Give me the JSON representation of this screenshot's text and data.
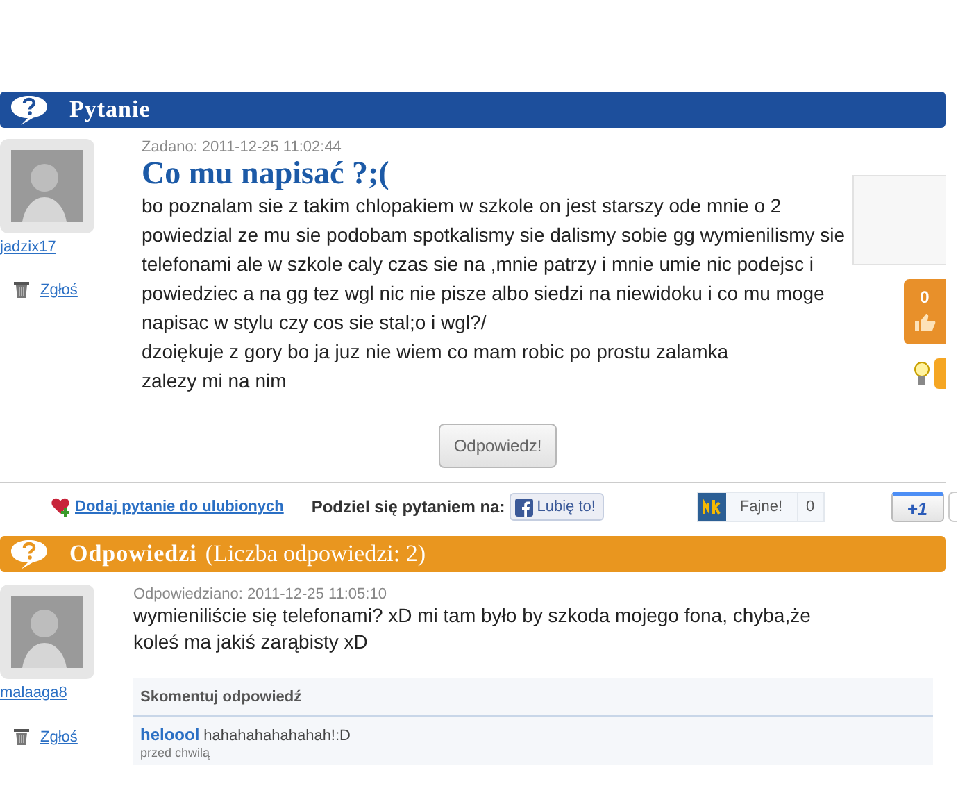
{
  "question_header": {
    "title": "Pytanie"
  },
  "question": {
    "author": "jadzix17",
    "report": "Zgłoś",
    "asked": "Zadano: 2011-12-25 11:02:44",
    "title": "Co mu napisać ?;(",
    "body": [
      "bo poznalam sie z takim chlopakiem w szkole on jest starszy ode mnie o 2",
      "powiedzial ze mu sie podobam spotkalismy sie dalismy sobie gg wymienilismy sie",
      "telefonami ale w szkole caly czas sie na ,mnie patrzy i mnie umie nic podejsc i",
      "powiedziec a na gg tez wgl nic nie pisze albo siedzi na niewidoku i co mu moge",
      "napisac w stylu czy cos sie stal;o i wgl?/",
      "dzoiękuje z gory bo ja juz nie wiem co mam robic po prostu zalamka",
      "zalezy mi na nim"
    ],
    "votes": "0",
    "answer_button": "Odpowiedz!"
  },
  "share": {
    "favorite": "Dodaj pytanie do ulubionych",
    "label": "Podziel się pytaniem na:",
    "facebook": "Lubię to!",
    "nk_label": "Fajne!",
    "nk_count": "0",
    "plus_one": "+1"
  },
  "answers_header": {
    "title": "Odpowiedzi",
    "count": "(Liczba odpowiedzi: 2)"
  },
  "answers": [
    {
      "author": "malaaga8",
      "report": "Zgłoś",
      "answered": "Odpowiedziano: 2011-12-25 11:05:10",
      "body": [
        "wymieniliście się telefonami? xD mi tam było by szkoda mojego fona, chyba,że",
        "koleś ma jakiś zarąbisty xD"
      ],
      "comment_header": "Skomentuj odpowiedź",
      "comments": [
        {
          "author": "heloool",
          "text": "hahahahahahahah!:D",
          "time": "przed chwilą"
        }
      ]
    }
  ]
}
